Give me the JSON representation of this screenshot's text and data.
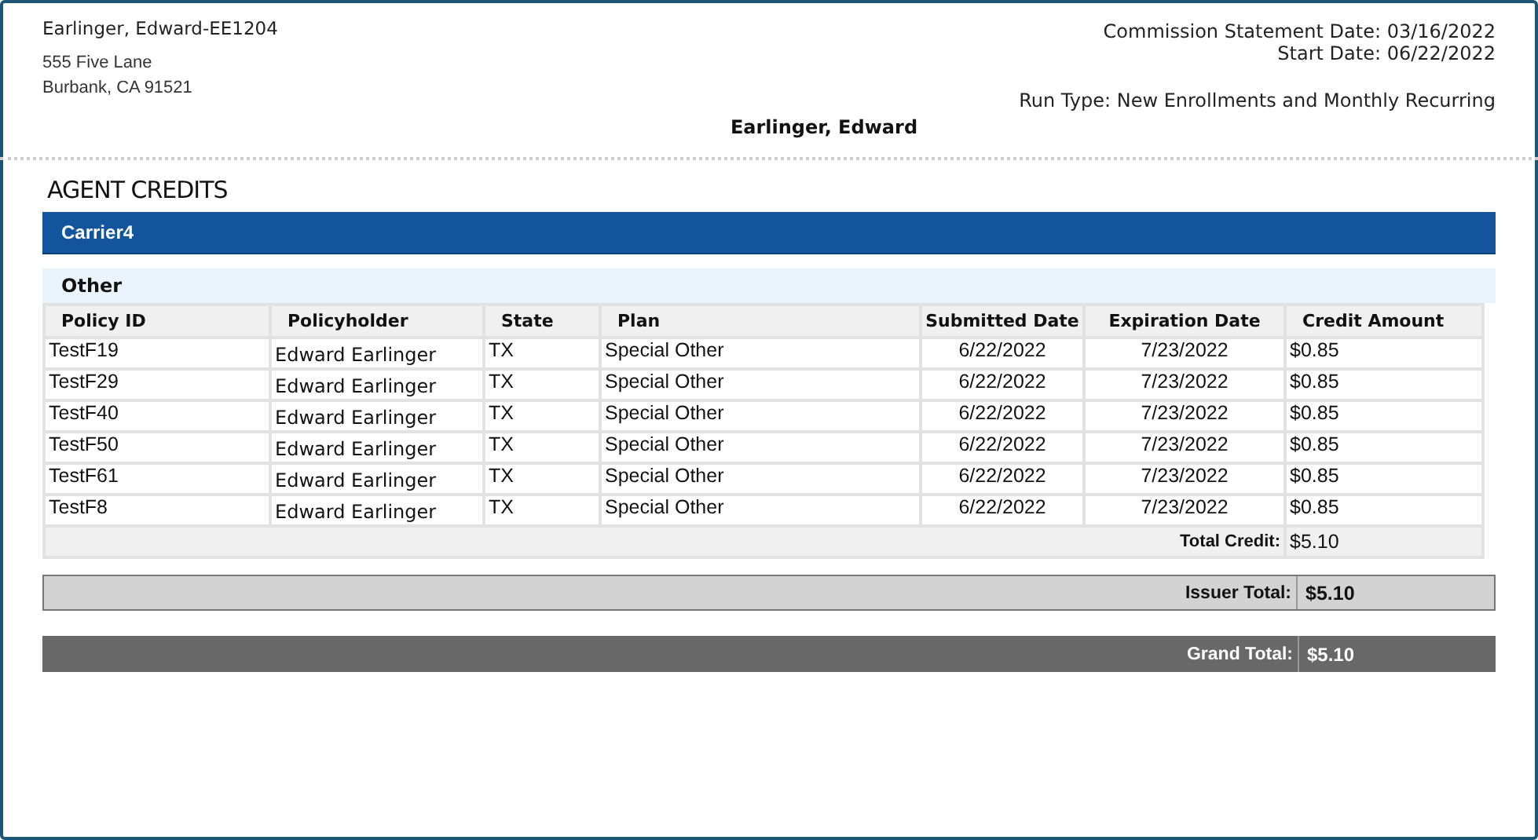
{
  "agent": {
    "name_id": "Earlinger, Edward-EE1204",
    "address_lines": [
      "555 Five Lane",
      "Burbank, CA 91521"
    ]
  },
  "statement": {
    "statement_date": "Commission Statement Date: 03/16/2022",
    "start_date": "Start Date: 06/22/2022",
    "run_type": "Run Type: New Enrollments and Monthly Recurring"
  },
  "agent_title": "Earlinger, Edward",
  "section_title": "AGENT CREDITS",
  "carrier": "Carrier4",
  "group": "Other",
  "table": {
    "columns": [
      "Policy ID",
      "Policyholder",
      "State",
      "Plan",
      "Submitted Date",
      "Expiration Date",
      "Credit Amount"
    ],
    "rows": [
      [
        "TestF19",
        "Edward Earlinger",
        "TX",
        "Special Other",
        "6/22/2022",
        "7/23/2022",
        "$0.85"
      ],
      [
        "TestF29",
        "Edward Earlinger",
        "TX",
        "Special Other",
        "6/22/2022",
        "7/23/2022",
        "$0.85"
      ],
      [
        "TestF40",
        "Edward Earlinger",
        "TX",
        "Special Other",
        "6/22/2022",
        "7/23/2022",
        "$0.85"
      ],
      [
        "TestF50",
        "Edward Earlinger",
        "TX",
        "Special Other",
        "6/22/2022",
        "7/23/2022",
        "$0.85"
      ],
      [
        "TestF61",
        "Edward Earlinger",
        "TX",
        "Special Other",
        "6/22/2022",
        "7/23/2022",
        "$0.85"
      ],
      [
        "TestF8",
        "Edward Earlinger",
        "TX",
        "Special Other",
        "6/22/2022",
        "7/23/2022",
        "$0.85"
      ]
    ],
    "total": {
      "label": "Total Credit:",
      "value": "$5.10"
    }
  },
  "issuer_total": {
    "label": "Issuer Total:",
    "value": "$5.10"
  },
  "grand_total": {
    "label": "Grand Total:",
    "value": "$5.10"
  }
}
